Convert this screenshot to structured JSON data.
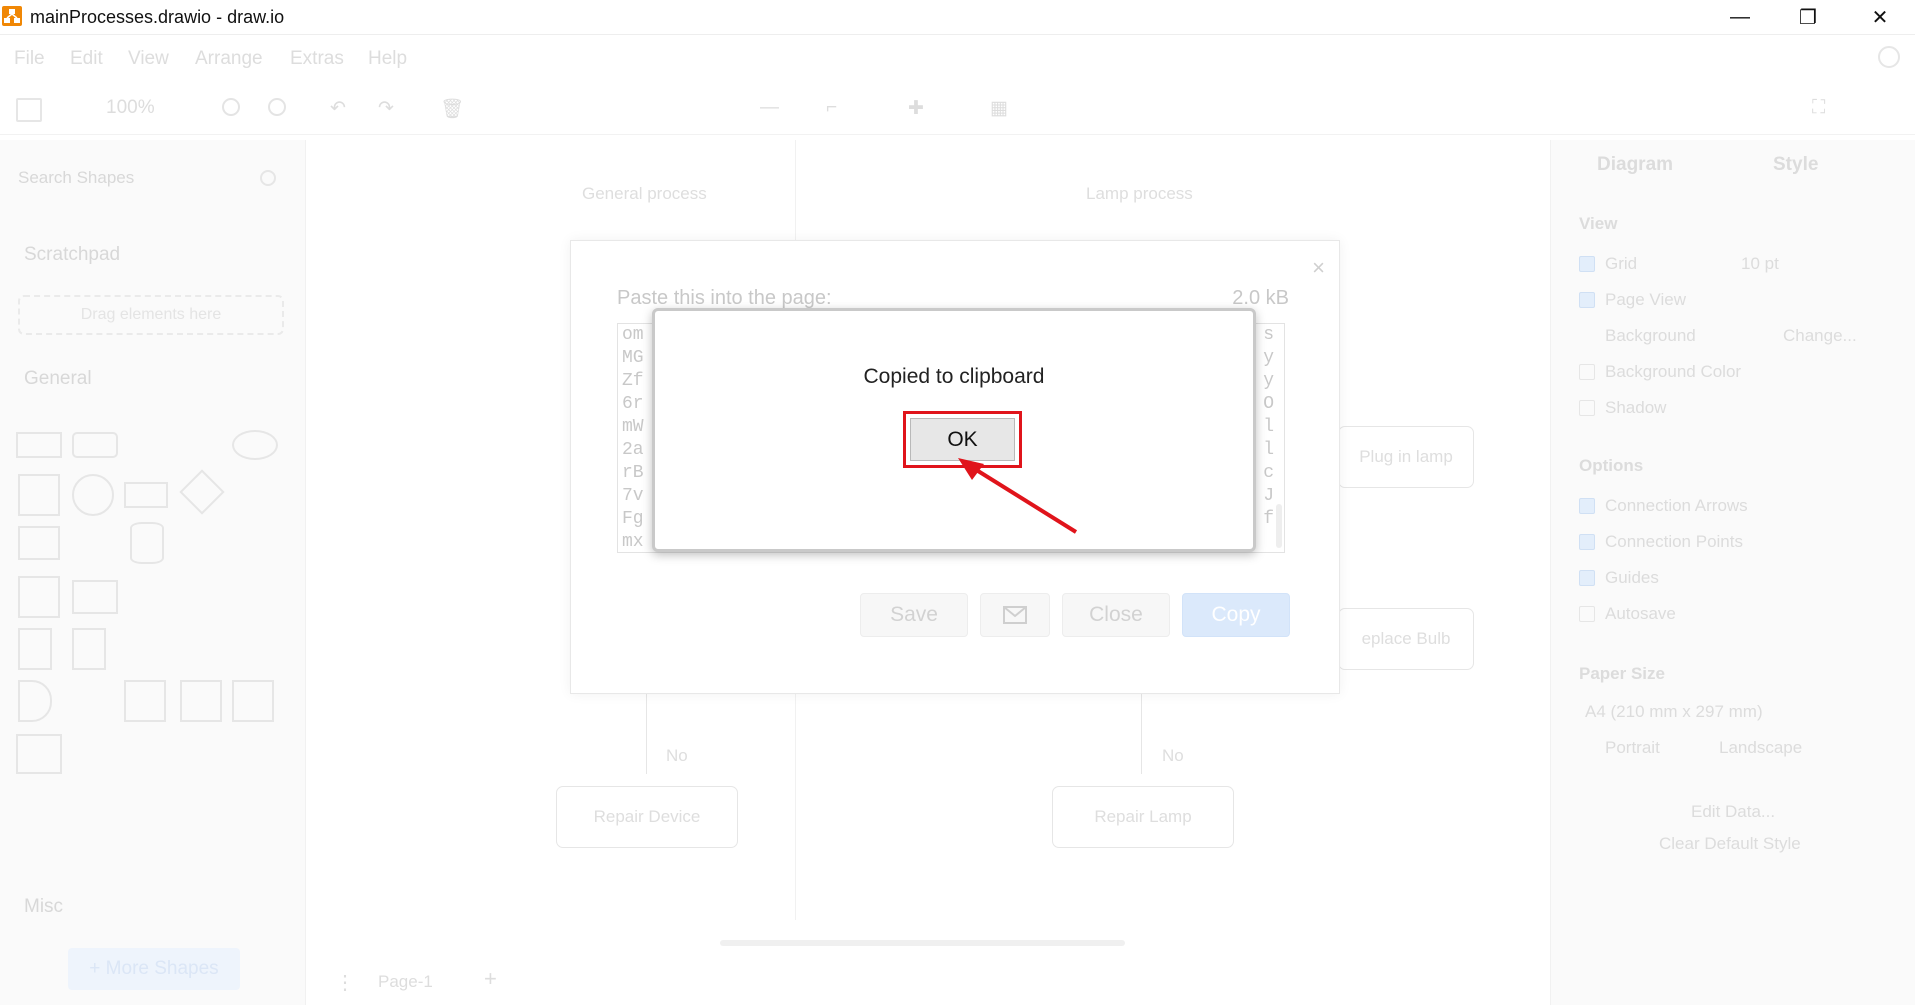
{
  "window": {
    "title": "mainProcesses.drawio - draw.io",
    "minimize": "—",
    "restore": "❐",
    "close": "✕"
  },
  "menu": [
    "File",
    "Edit",
    "View",
    "Arrange",
    "Extras",
    "Help"
  ],
  "toolbar": {
    "zoom": "100%"
  },
  "left_panel": {
    "search_placeholder": "Search Shapes",
    "scratchpad": "Scratchpad",
    "drop_here": "Drag elements here",
    "general": "General",
    "misc": "Misc",
    "more_shapes": "+ More Shapes"
  },
  "canvas": {
    "lane1": "General process",
    "lane2": "Lamp process",
    "node_plug": "Plug in lamp",
    "node_bulb": "eplace Bulb",
    "no1": "No",
    "no2": "No",
    "repair_device": "Repair Device",
    "repair_lamp": "Repair Lamp",
    "page_tab": "Page-1"
  },
  "right_panel": {
    "tab_diagram": "Diagram",
    "tab_style": "Style",
    "view": "View",
    "grid": "Grid",
    "grid_size": "10 pt",
    "page_view": "Page View",
    "background": "Background",
    "change": "Change...",
    "bg_color": "Background Color",
    "shadow": "Shadow",
    "options": "Options",
    "conn_arrows": "Connection Arrows",
    "conn_points": "Connection Points",
    "guides": "Guides",
    "autosave": "Autosave",
    "paper_size": "Paper Size",
    "paper_value": "A4 (210 mm x 297 mm)",
    "portrait": "Portrait",
    "landscape": "Landscape",
    "edit_data": "Edit Data...",
    "clear_style": "Clear Default Style"
  },
  "export_dialog": {
    "close": "×",
    "label": "Paste this into the page:",
    "size": "2.0 kB",
    "code_lines": [
      "om",
      "MG",
      "Zf",
      "6r",
      "mW",
      "2a",
      "rB",
      "7v",
      "Fg",
      "mx"
    ],
    "code_tail": [
      "s",
      "y",
      "y",
      "O",
      "l",
      "l",
      "c",
      "J",
      "f",
      ""
    ],
    "save": "Save",
    "email_icon": "envelope-icon",
    "close_btn": "Close",
    "copy": "Copy"
  },
  "modal": {
    "message": "Copied to clipboard",
    "ok": "OK"
  },
  "colors": {
    "highlight_red": "#e0141b",
    "copy_blue": "#dbe9fb",
    "drawio_orange": "#f08705"
  }
}
